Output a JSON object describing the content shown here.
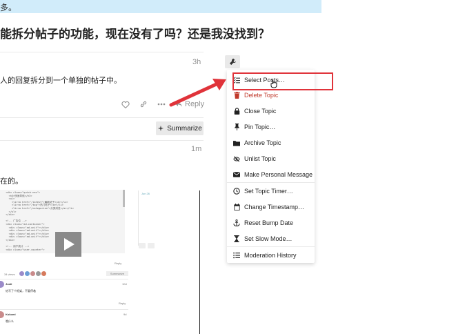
{
  "banner": {
    "text": "多。"
  },
  "topic": {
    "title": "能拆分帖子的功能，现在没有了吗？还是我没找到？"
  },
  "post1": {
    "time": "3h",
    "body": "人的回复拆分到一个单独的帖子中。",
    "reply_label": "Reply"
  },
  "summarize": {
    "label": "Summarize"
  },
  "post2": {
    "time": "1m",
    "body": "在的。"
  },
  "admin_menu": {
    "items": [
      {
        "label": "Select Posts…",
        "icon": "select-list-icon",
        "danger": false
      },
      {
        "label": "Delete Topic",
        "icon": "trash-icon",
        "danger": true
      },
      {
        "label": "Close Topic",
        "icon": "lock-icon",
        "danger": false
      },
      {
        "label": "Pin Topic…",
        "icon": "thumbtack-icon",
        "danger": false
      },
      {
        "label": "Archive Topic",
        "icon": "folder-icon",
        "danger": false
      },
      {
        "label": "Unlist Topic",
        "icon": "eye-slash-icon",
        "danger": false
      },
      {
        "label": "Make Personal Message",
        "icon": "envelope-icon",
        "danger": false
      },
      {
        "label": "Set Topic Timer…",
        "icon": "clock-icon",
        "danger": false
      },
      {
        "label": "Change Timestamp…",
        "icon": "calendar-icon",
        "danger": false
      },
      {
        "label": "Reset Bump Date",
        "icon": "anchor-icon",
        "danger": false
      },
      {
        "label": "Set Slow Mode…",
        "icon": "hourglass-icon",
        "danger": false
      },
      {
        "label": "Moderation History",
        "icon": "list-icon",
        "danger": false
      }
    ]
  },
  "embedded": {
    "code_lines": [
      "  <div class=\"quick-nav\">",
      "    <h3>快速导航</h3>",
      "    <ul>",
      "      <li><a href=\"/latest\">最新帖子</a></li>",
      "      <li><a href=\"/top\">热门帖子</a></li>",
      "      <li><a href=\"/categories\">分类浏览</a></li>",
      "    </ul>",
      "  </div>",
      "",
      "  <!-- 广告位 -->",
      "  <div class=\"ad-container\">",
      "    <div class=\"ad-unit\"></div>",
      "    <div class=\"ad-unit\"></div>",
      "    <div class=\"ad-unit\"></div>",
      "    <div class=\"ad-unit\"></div>",
      "  </div>",
      "",
      "  <!-- 用户统计 -->",
      "  <div class=\"user-counter\">"
    ],
    "date": "Jun 26",
    "views": "34 views",
    "summarize_label": "Summarize",
    "reply_label": "Reply",
    "reply1": {
      "user": "Justi",
      "time": "10d",
      "body": "给写了个框架，不要停着"
    },
    "reply2": {
      "user": "Kokomi",
      "time": "9d",
      "body": "哦什么"
    }
  },
  "colors": {
    "accent": "#e0333a",
    "banner": "#d1ecfa",
    "danger": "#c0392b"
  }
}
